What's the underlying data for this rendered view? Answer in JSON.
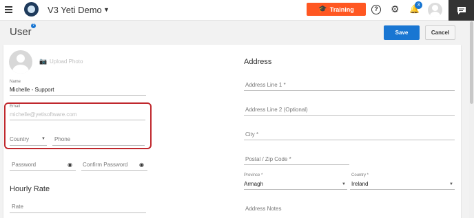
{
  "topbar": {
    "app_title": "V3 Yeti Demo",
    "training_label": "Training",
    "notification_count": "3",
    "help_glyph": "?",
    "icons": [
      "hamburger-icon",
      "logo-icon",
      "chevron-down-icon",
      "graduation-cap-icon",
      "help-icon",
      "gear-icon",
      "bell-icon",
      "avatar",
      "chat-icon"
    ]
  },
  "header": {
    "title": "User",
    "help_glyph": "?",
    "save_label": "Save",
    "cancel_label": "Cancel"
  },
  "user": {
    "upload_photo_label": "Upload Photo",
    "name": {
      "label": "Name",
      "value": "Michelle - Support"
    },
    "email": {
      "label": "Email",
      "value": "michelle@yetisoftware.com"
    },
    "country_placeholder": "Country",
    "phone_placeholder": "Phone",
    "password_placeholder": "Password",
    "confirm_password_placeholder": "Confirm Password",
    "hourly_rate_title": "Hourly Rate",
    "rate_placeholder": "Rate"
  },
  "address": {
    "title": "Address",
    "line1_placeholder": "Address Line 1 *",
    "line2_placeholder": "Address Line 2 (Optional)",
    "city_placeholder": "City *",
    "postal_placeholder": "Postal / Zip Code *",
    "province": {
      "label": "Province *",
      "value": "Armagh"
    },
    "country": {
      "label": "Country *",
      "value": "Ireland"
    },
    "notes_placeholder": "Address Notes"
  },
  "colors": {
    "accent": "#1976d2",
    "training": "#ff5722",
    "highlight_box": "#c0282d"
  }
}
